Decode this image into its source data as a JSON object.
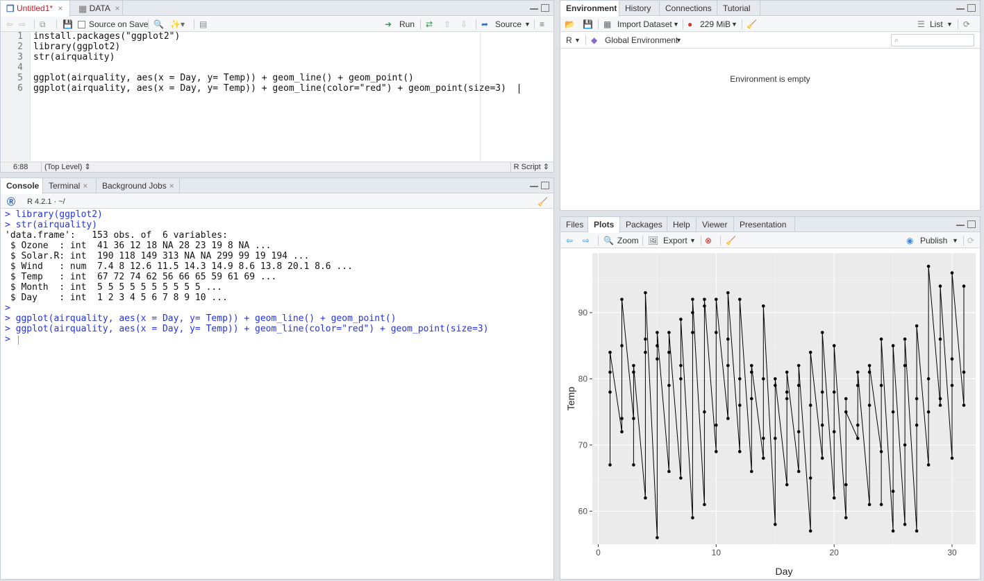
{
  "editor": {
    "tabs": [
      {
        "label": "Untitled1*"
      },
      {
        "label": "DATA"
      }
    ],
    "source_on_save_label": "Source on Save",
    "run_label": "Run",
    "source_label": "Source",
    "lines": [
      "install.packages(\"ggplot2\")",
      "library(ggplot2)",
      "str(airquality)",
      "",
      "ggplot(airquality, aes(x = Day, y= Temp)) + geom_line() + geom_point()",
      "ggplot(airquality, aes(x = Day, y= Temp)) + geom_line(color=\"red\") + geom_point(size=3)"
    ],
    "line_numbers": [
      "1",
      "2",
      "3",
      "4",
      "5",
      "6"
    ],
    "status_position": "6:88",
    "status_scope": "(Top Level) ⇕",
    "status_filetype": "R Script ⇕"
  },
  "console": {
    "tabs": [
      {
        "label": "Console"
      },
      {
        "label": "Terminal"
      },
      {
        "label": "Background Jobs"
      }
    ],
    "r_version": "R 4.2.1 · ~/",
    "lines": [
      {
        "text": "> library(ggplot2)",
        "style": "blue"
      },
      {
        "text": "> str(airquality)",
        "style": "blue"
      },
      {
        "text": "'data.frame':   153 obs. of  6 variables:",
        "style": "normal"
      },
      {
        "text": " $ Ozone  : int  41 36 12 18 NA 28 23 19 8 NA ...",
        "style": "normal"
      },
      {
        "text": " $ Solar.R: int  190 118 149 313 NA NA 299 99 19 194 ...",
        "style": "normal"
      },
      {
        "text": " $ Wind   : num  7.4 8 12.6 11.5 14.3 14.9 8.6 13.8 20.1 8.6 ...",
        "style": "normal"
      },
      {
        "text": " $ Temp   : int  67 72 74 62 56 66 65 59 61 69 ...",
        "style": "normal"
      },
      {
        "text": " $ Month  : int  5 5 5 5 5 5 5 5 5 5 ...",
        "style": "normal"
      },
      {
        "text": " $ Day    : int  1 2 3 4 5 6 7 8 9 10 ...",
        "style": "normal"
      },
      {
        "text": ">",
        "style": "blue"
      },
      {
        "text": "> ggplot(airquality, aes(x = Day, y= Temp)) + geom_line() + geom_point()",
        "style": "blue"
      },
      {
        "text": "> ggplot(airquality, aes(x = Day, y= Temp)) + geom_line(color=\"red\") + geom_point(size=3)",
        "style": "blue"
      },
      {
        "text": "> ",
        "style": "blue"
      }
    ]
  },
  "environment": {
    "tabs": [
      {
        "label": "Environment"
      },
      {
        "label": "History"
      },
      {
        "label": "Connections"
      },
      {
        "label": "Tutorial"
      }
    ],
    "import_label": "Import Dataset",
    "memory_label": "229 MiB",
    "list_label": "List",
    "lang_label": "R",
    "scope_label": "Global Environment",
    "empty_message": "Environment is empty"
  },
  "plots": {
    "tabs": [
      {
        "label": "Files"
      },
      {
        "label": "Plots"
      },
      {
        "label": "Packages"
      },
      {
        "label": "Help"
      },
      {
        "label": "Viewer"
      },
      {
        "label": "Presentation"
      }
    ],
    "zoom_label": "Zoom",
    "export_label": "Export",
    "publish_label": "Publish"
  },
  "chart_data": {
    "type": "line",
    "title": "",
    "xlabel": "Day",
    "ylabel": "Temp",
    "xlim": [
      -0.5,
      32
    ],
    "ylim": [
      55,
      99
    ],
    "x_ticks": [
      0,
      10,
      20,
      30
    ],
    "y_ticks": [
      60,
      70,
      80,
      90
    ],
    "grid": true,
    "series": [
      {
        "x": [
          1,
          1,
          1,
          1,
          2,
          2,
          2,
          2,
          3,
          3,
          3,
          3,
          4,
          4,
          4,
          4,
          5,
          5,
          5,
          5,
          6,
          6,
          6,
          6,
          7,
          7,
          7,
          7,
          8,
          8,
          8,
          8,
          9,
          9,
          9,
          9,
          10,
          10,
          10,
          10,
          11,
          11,
          11,
          11,
          12,
          12,
          12,
          12,
          13,
          13,
          13,
          13,
          14,
          14,
          14,
          14,
          15,
          15,
          15,
          15,
          16,
          16,
          16,
          16,
          17,
          17,
          17,
          17,
          18,
          18,
          18,
          18,
          19,
          19,
          19,
          19,
          20,
          20,
          20,
          20,
          21,
          21,
          21,
          21,
          22,
          22,
          22,
          22,
          23,
          23,
          23,
          23,
          24,
          24,
          24,
          24,
          25,
          25,
          25,
          25,
          26,
          26,
          26,
          26,
          27,
          27,
          27,
          27,
          28,
          28,
          28,
          28,
          29,
          29,
          29,
          29,
          30,
          30,
          30,
          30,
          31,
          31,
          31
        ],
        "y": [
          67,
          78,
          81,
          84,
          72,
          74,
          85,
          92,
          74,
          67,
          81,
          82,
          62,
          84,
          86,
          93,
          56,
          83,
          85,
          87,
          66,
          79,
          84,
          87,
          65,
          80,
          82,
          89,
          59,
          87,
          90,
          92,
          61,
          75,
          91,
          92,
          69,
          73,
          87,
          92,
          74,
          82,
          86,
          93,
          69,
          76,
          80,
          92,
          66,
          77,
          81,
          82,
          68,
          71,
          80,
          91,
          58,
          79,
          71,
          80,
          64,
          77,
          78,
          81,
          66,
          72,
          79,
          82,
          57,
          65,
          76,
          84,
          68,
          73,
          78,
          87,
          62,
          72,
          78,
          85,
          59,
          64,
          77,
          75,
          71,
          73,
          79,
          81,
          61,
          76,
          81,
          82,
          69,
          79,
          61,
          86,
          57,
          63,
          75,
          85,
          58,
          70,
          82,
          86,
          57,
          73,
          77,
          88,
          67,
          75,
          80,
          97,
          76,
          77,
          86,
          94,
          68,
          79,
          83,
          96,
          76,
          81,
          94
        ]
      }
    ]
  }
}
